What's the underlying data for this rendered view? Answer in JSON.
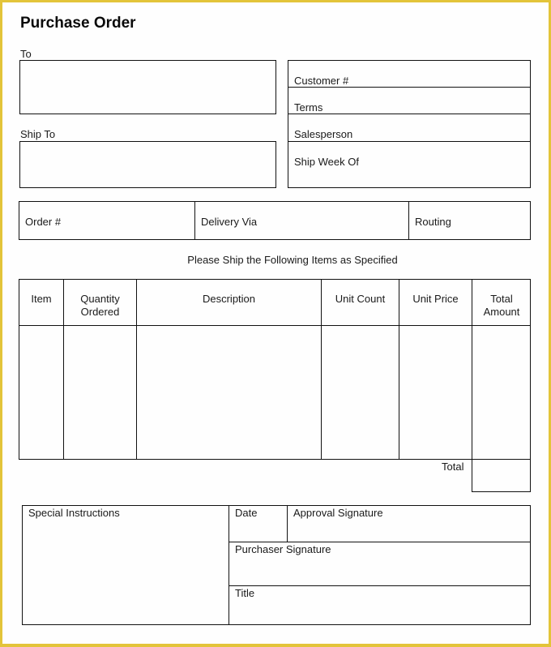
{
  "document": {
    "title": "Purchase Order",
    "colors": {
      "frame": "#e3c43a",
      "lines": "#111111"
    }
  },
  "address": {
    "to_label": "To",
    "ship_to_label": "Ship To"
  },
  "customer_info": {
    "fields": [
      "Customer #",
      "Terms",
      "Salesperson",
      "Ship Week Of"
    ]
  },
  "order_info": {
    "fields": [
      "Order #",
      "Delivery Via",
      "Routing"
    ]
  },
  "items": {
    "instruction": "Please Ship the Following Items as Specified",
    "columns": [
      [
        "Item"
      ],
      [
        "Quantity",
        "Ordered"
      ],
      [
        "Description"
      ],
      [
        "Unit Count"
      ],
      [
        "Unit Price"
      ],
      [
        "Total",
        "Amount"
      ]
    ],
    "rows": [],
    "total_label": "Total",
    "total_value": ""
  },
  "footer": {
    "special_instructions_label": "Special Instructions",
    "date_label": "Date",
    "approval_signature_label": "Approval Signature",
    "purchaser_signature_label": "Purchaser Signature",
    "title_label": "Title"
  }
}
